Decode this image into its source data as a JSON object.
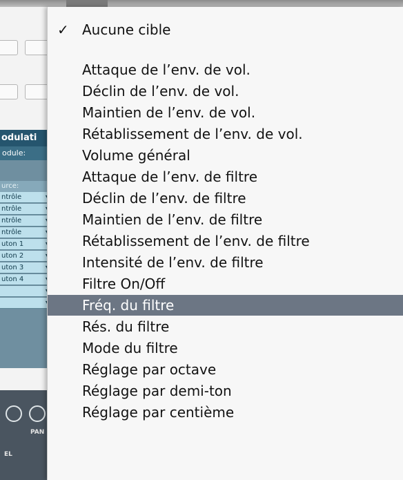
{
  "background_app": {
    "panel_title": "odulati",
    "module_label": "odule:",
    "source_header": "urce:",
    "source_slots": [
      "ntrôle",
      "ntrôle",
      "ntrôle",
      "ntrôle",
      "uton 1",
      "uton 2",
      "uton 3",
      "uton 4",
      "",
      ""
    ],
    "pan_label": "PAN",
    "el_label": "EL"
  },
  "menu": {
    "selected_index": 12,
    "checked_item": {
      "label": "Aucune cible",
      "check": "✓"
    },
    "items": [
      "Attaque de l’env. de vol.",
      "Déclin de l’env. de vol.",
      "Maintien de l’env. de vol.",
      "Rétablissement de l’env. de vol.",
      "Volume général",
      "Attaque de l’env. de filtre",
      "Déclin de l’env. de filtre",
      "Maintien de l’env. de filtre",
      "Rétablissement de l’env. de filtre",
      "Intensité de l’env. de filtre",
      "Filtre On/Off",
      "Fréq. du filtre",
      "Rés. du filtre",
      "Mode du filtre",
      "Réglage par octave",
      "Réglage par demi-ton",
      "Réglage par centième"
    ]
  },
  "colors": {
    "menu_background": "#f7f7f7",
    "selection_highlight": "#6c7684",
    "panel_title": "#25556e",
    "slot_background": "#bde0ec"
  }
}
